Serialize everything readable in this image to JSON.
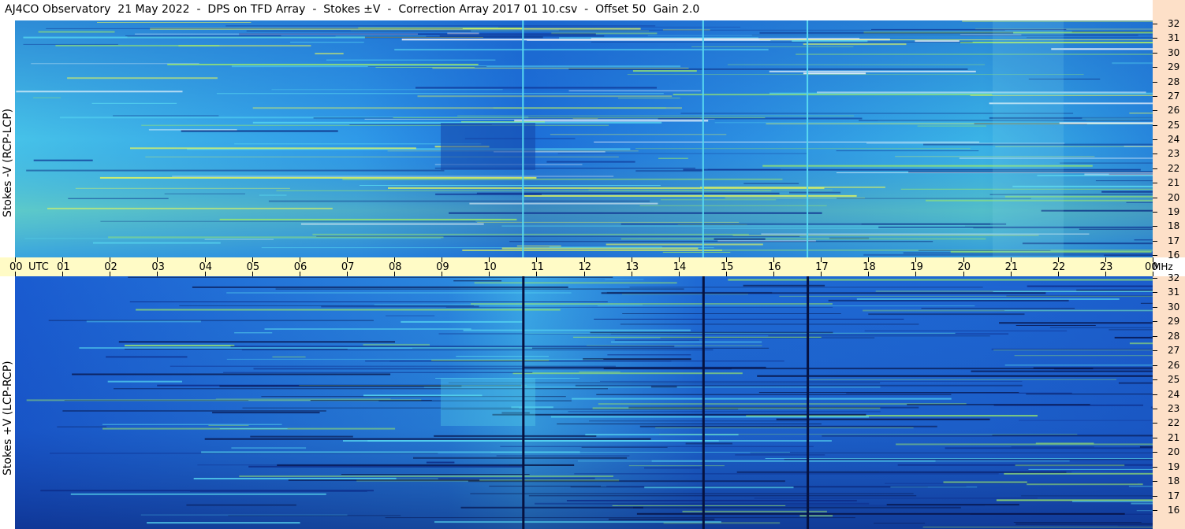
{
  "title": "AJ4CO Observatory  21 May 2022  -  DPS on TFD Array  -  Stokes ±V  -  Correction Array 2017 01 10.csv  -  Offset 50  Gain 2.0",
  "top_panel_label": "Stokes -V (RCP-LCP)",
  "bottom_panel_label": "Stokes +V (LCP-RCP)",
  "time_axis": {
    "labels": [
      "00",
      "01",
      "02",
      "03",
      "04",
      "05",
      "06",
      "07",
      "08",
      "09",
      "10",
      "11",
      "12",
      "13",
      "14",
      "15",
      "16",
      "17",
      "18",
      "19",
      "20",
      "21",
      "22",
      "23",
      "00"
    ],
    "utc_label": "UTC",
    "unit_label": "MHz"
  },
  "freq_axis": {
    "labels": [
      "32",
      "31",
      "30",
      "29",
      "28",
      "27",
      "26",
      "25",
      "24",
      "23",
      "22",
      "21",
      "20",
      "19",
      "18",
      "17",
      "16"
    ]
  },
  "colors": {
    "background_blue": "#1f7ee6",
    "time_bar": "#fffbc6",
    "freq_bar": "#fde0c8"
  },
  "chart_data": {
    "type": "heatmap",
    "title": "AJ4CO Observatory  21 May 2022  -  DPS on TFD Array  -  Stokes ±V  -  Correction Array 2017 01 10.csv  -  Offset 50  Gain 2.0",
    "x_axis": {
      "label": "UTC",
      "range": [
        0,
        24
      ],
      "unit": "hours"
    },
    "y_axis": {
      "label": "MHz",
      "range": [
        16,
        32
      ]
    },
    "panels": [
      {
        "name": "Stokes -V (RCP-LCP)",
        "vertical_lines_utc": [
          10.7,
          14.5,
          16.7
        ]
      },
      {
        "name": "Stokes +V (LCP-RCP)",
        "vertical_lines_utc": [
          10.7,
          14.5,
          16.7
        ]
      }
    ]
  }
}
